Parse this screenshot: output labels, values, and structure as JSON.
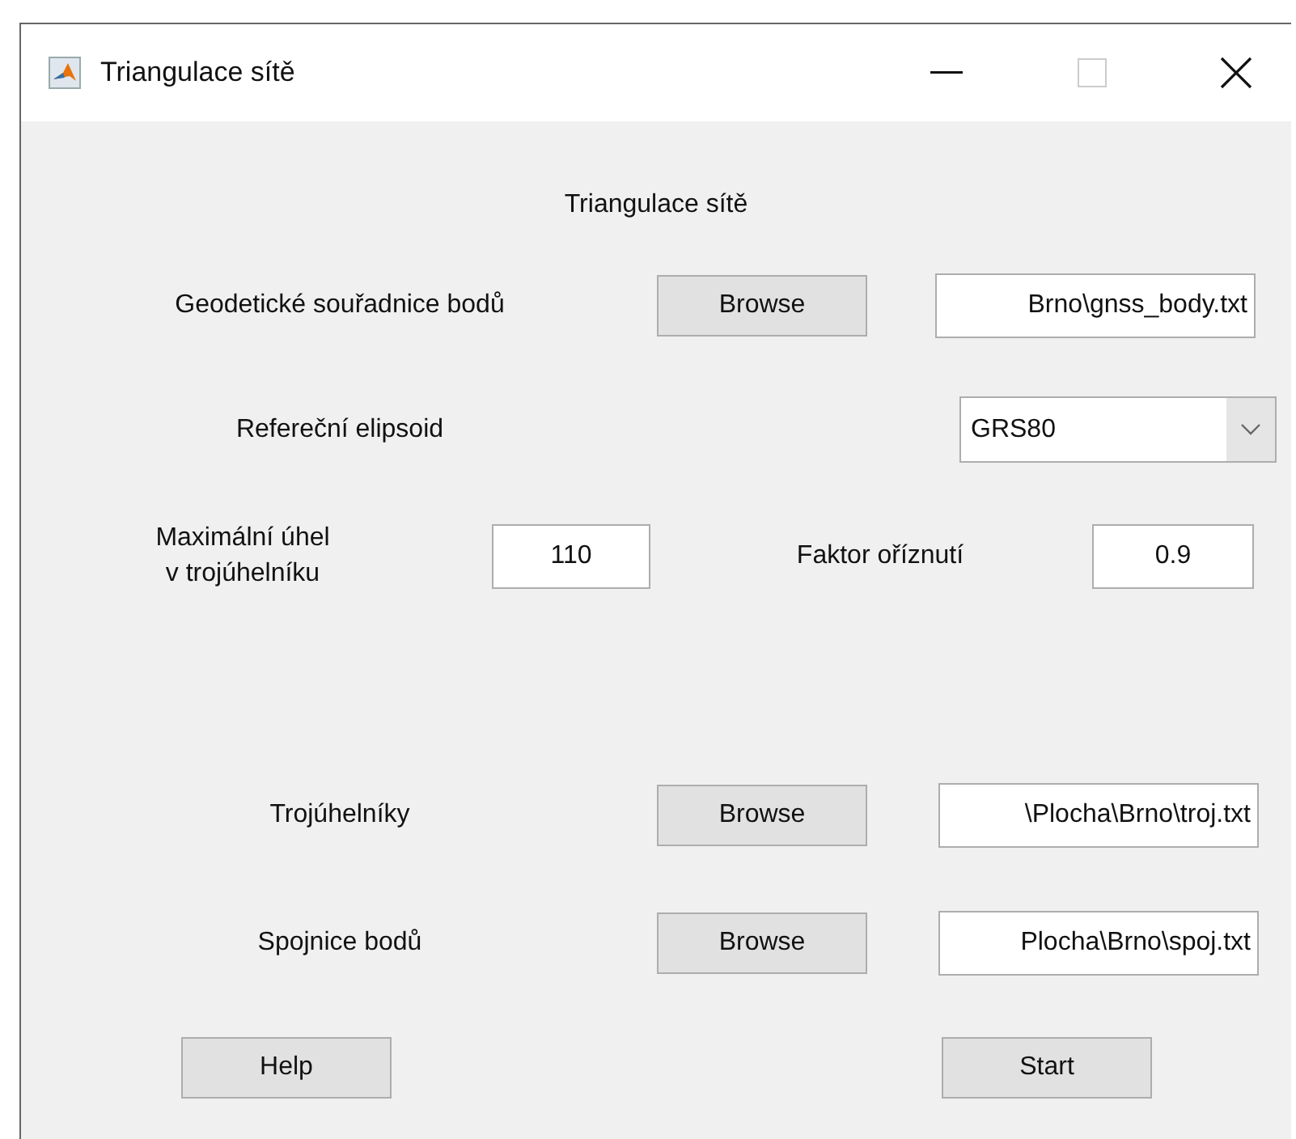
{
  "window": {
    "title": "Triangulace sítě"
  },
  "heading": "Triangulace sítě",
  "points_file": {
    "label": "Geodetické souřadnice bodů",
    "button": "Browse",
    "value": "Brno\\gnss_body.txt"
  },
  "ellipsoid": {
    "label": "Refereční elipsoid",
    "value": "GRS80"
  },
  "max_angle": {
    "label_lines": [
      "Maximální úhel",
      "v trojúhelníku"
    ],
    "value": "110"
  },
  "clip_factor": {
    "label": "Faktor oříznutí",
    "value": "0.9"
  },
  "outputs": [
    {
      "label": "Trojúhelníky",
      "button": "Browse",
      "value": "\\Plocha\\Brno\\troj.txt"
    },
    {
      "label": "Spojnice bodů",
      "button": "Browse",
      "value": "Plocha\\Brno\\spoj.txt"
    }
  ],
  "buttons": [
    "Help",
    "Start"
  ]
}
